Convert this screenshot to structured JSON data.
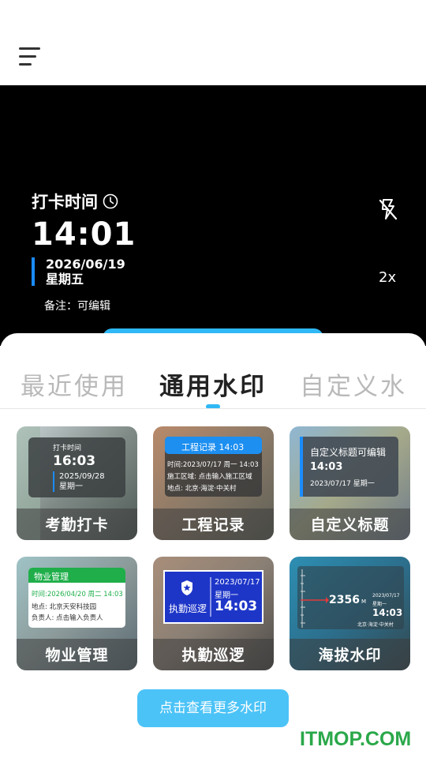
{
  "camera": {
    "watermark": {
      "title": "打卡时间",
      "time": "14:01",
      "date": "2026/06/19",
      "weekday": "星期五",
      "note": "备注：可编辑"
    },
    "zoom": "2x",
    "flash_icon": "flash-off-icon"
  },
  "tabs": [
    {
      "label": "最近使用",
      "active": false
    },
    {
      "label": "通用水印",
      "active": true
    },
    {
      "label": "自定义水",
      "active": false
    }
  ],
  "cards": [
    {
      "label": "考勤打卡",
      "preview": {
        "title": "打卡时间",
        "time": "16:03",
        "date": "2025/09/28",
        "weekday": "星期一"
      }
    },
    {
      "label": "工程记录",
      "preview": {
        "header": "工程记录 14:03",
        "line1": "时间:2023/07/17 周一 14:03",
        "line2": "施工区域: 点击输入施工区域",
        "line3": "地点: 北京·海淀·中关村"
      }
    },
    {
      "label": "自定义标题",
      "preview": {
        "title": "自定义标题可编辑",
        "time": "14:03",
        "date": "2023/07/17 星期一"
      }
    },
    {
      "label": "物业管理",
      "preview": {
        "header": "物业管理",
        "line1": "时间:2026/04/20 周二 14:03",
        "line2": "地点: 北京天安科技园",
        "line3": "负责人: 点击输入负责人"
      }
    },
    {
      "label": "执勤巡逻",
      "preview": {
        "badge": "执勤巡逻",
        "date": "2023/07/17",
        "weekday": "星期一",
        "time": "14:03"
      }
    },
    {
      "label": "海拔水印",
      "preview": {
        "altitude": "2356",
        "unit": "M",
        "date": "2023/07/17",
        "weekday": "星期一",
        "time": "14:03",
        "location": "北京·海淀·中关村"
      }
    }
  ],
  "more_button": "点击查看更多水印",
  "brand": "ITMOP.COM",
  "colors": {
    "accent": "#2fb8f5",
    "date_bar": "#1a8cff",
    "brand": "#2aa84a",
    "green_header": "#1fae4a",
    "blue_badge": "#1e36c8"
  }
}
